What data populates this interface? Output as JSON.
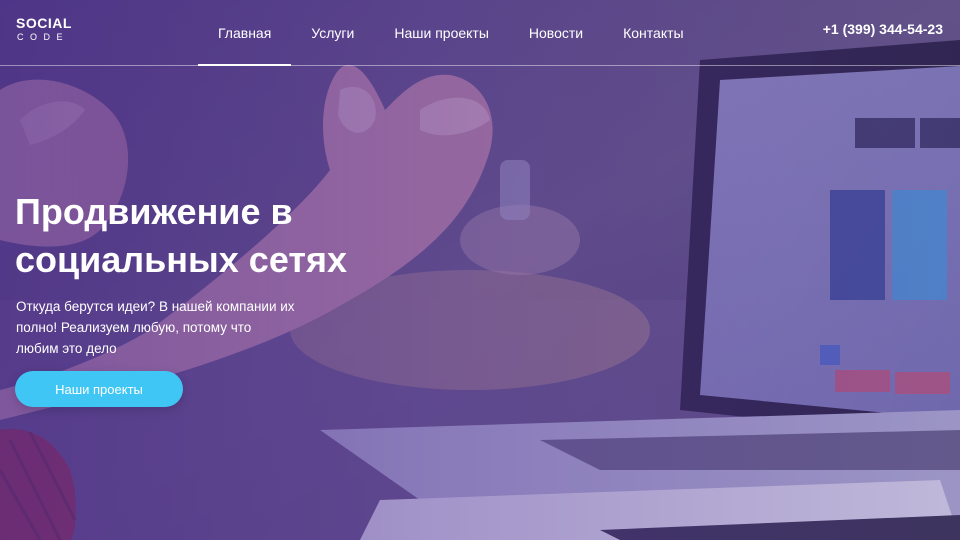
{
  "logo": {
    "top": "SOCIAL",
    "bottom": "CODE"
  },
  "nav": {
    "items": [
      {
        "label": "Главная",
        "active": true
      },
      {
        "label": "Услуги",
        "active": false
      },
      {
        "label": "Наши проекты",
        "active": false
      },
      {
        "label": "Новости",
        "active": false
      },
      {
        "label": "Контакты",
        "active": false
      }
    ]
  },
  "header": {
    "phone": "+1 (399) 344-54-23"
  },
  "hero": {
    "title_lines": [
      "Продвижение в",
      "социальных сетях"
    ],
    "subtitle_lines": [
      "Откуда берутся идеи? В нашей компании их",
      "полно! Реализуем любую, потому что",
      "любим это дело"
    ],
    "cta_label": "Наши проекты"
  },
  "colors": {
    "accent": "#3fc6f5",
    "overlay": "#4a2a8c",
    "text": "#ffffff"
  }
}
